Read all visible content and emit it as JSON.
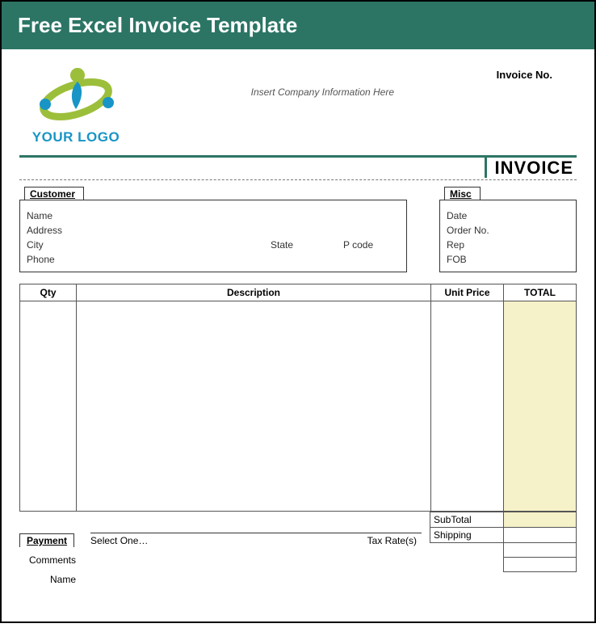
{
  "banner": {
    "title": "Free Excel Invoice Template"
  },
  "header": {
    "logo_caption": "YOUR LOGO",
    "company_hint": "Insert Company Information Here",
    "invoice_no_label": "Invoice No.",
    "invoice_title": "INVOICE"
  },
  "customer": {
    "tab": "Customer",
    "name_label": "Name",
    "address_label": "Address",
    "city_label": "City",
    "state_label": "State",
    "pcode_label": "P code",
    "phone_label": "Phone"
  },
  "misc": {
    "tab": "Misc",
    "date_label": "Date",
    "orderno_label": "Order No.",
    "rep_label": "Rep",
    "fob_label": "FOB"
  },
  "columns": {
    "qty": "Qty",
    "desc": "Description",
    "price": "Unit Price",
    "total": "TOTAL"
  },
  "totals": {
    "subtotal_label": "SubTotal",
    "shipping_label": "Shipping",
    "taxrates_label": "Tax Rate(s)"
  },
  "payment": {
    "tab": "Payment",
    "select_text": "Select One…"
  },
  "comments": {
    "label": "Comments",
    "name_label": "Name"
  }
}
